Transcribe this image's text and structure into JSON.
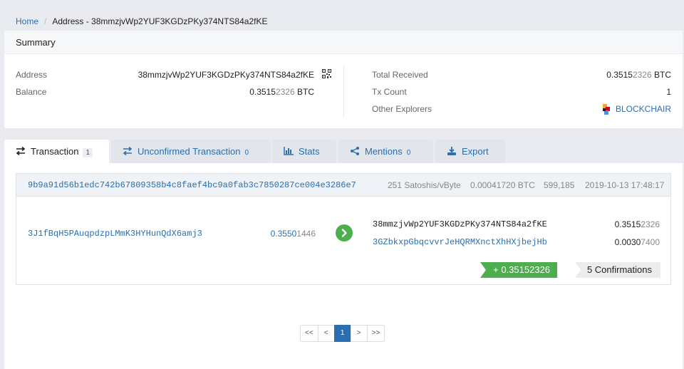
{
  "breadcrumb": {
    "home": "Home",
    "current": "Address - 38mmzjvWp2YUF3KGDzPKy374NTS84a2fKE"
  },
  "summary": {
    "title": "Summary",
    "address_label": "Address",
    "address_value": "38mmzjvWp2YUF3KGDzPKy374NTS84a2fKE",
    "balance_label": "Balance",
    "balance_main": "0.3515",
    "balance_faded": "2326",
    "balance_unit": " BTC",
    "total_received_label": "Total Received",
    "total_received_main": "0.3515",
    "total_received_faded": "2326",
    "total_received_unit": " BTC",
    "tx_count_label": "Tx Count",
    "tx_count_value": "1",
    "other_explorers_label": "Other Explorers",
    "explorer_link": "BLOCKCHAIR"
  },
  "tabs": [
    {
      "label": "Transaction",
      "count": "1",
      "icon": "transfer-icon"
    },
    {
      "label": "Unconfirmed Transaction",
      "count": "0",
      "icon": "transfer-icon"
    },
    {
      "label": "Stats",
      "count": "",
      "icon": "bar-chart-icon"
    },
    {
      "label": "Mentions",
      "count": "0",
      "icon": "share-icon"
    },
    {
      "label": "Export",
      "count": "",
      "icon": "download-icon"
    }
  ],
  "tx": {
    "hash": "9b9a91d56b1edc742b67809358b4c8faef4bc9a0fab3c7850287ce004e3286e7",
    "fee_rate": "251 Satoshis/vByte",
    "fee": "0.00041720 BTC",
    "block": "599,185",
    "time": "2019-10-13 17:48:17",
    "input": {
      "address": "3J1fBqH5PAuqpdzpLMmK3HYHunQdX6amj3",
      "amount_main": "0.3550",
      "amount_faded": "1446"
    },
    "outputs": [
      {
        "address": "38mmzjvWp2YUF3KGDzPKy374NTS84a2fKE",
        "amount_main": "0.3515",
        "amount_faded": "2326"
      },
      {
        "address": "3GZbkxpGbqcvvrJeHQRMXnctXhHXjbejHb",
        "amount_main": "0.0030",
        "amount_faded": "7400"
      }
    ],
    "received": "+ 0.35152326",
    "confirmations": "5 Confirmations"
  },
  "pagination": {
    "first": "<<",
    "prev": "<",
    "current": "1",
    "next": ">",
    "last": ">>"
  },
  "colors": {
    "link": "#2a6fb0",
    "success": "#4cae4c",
    "background": "#e9ebf0"
  }
}
